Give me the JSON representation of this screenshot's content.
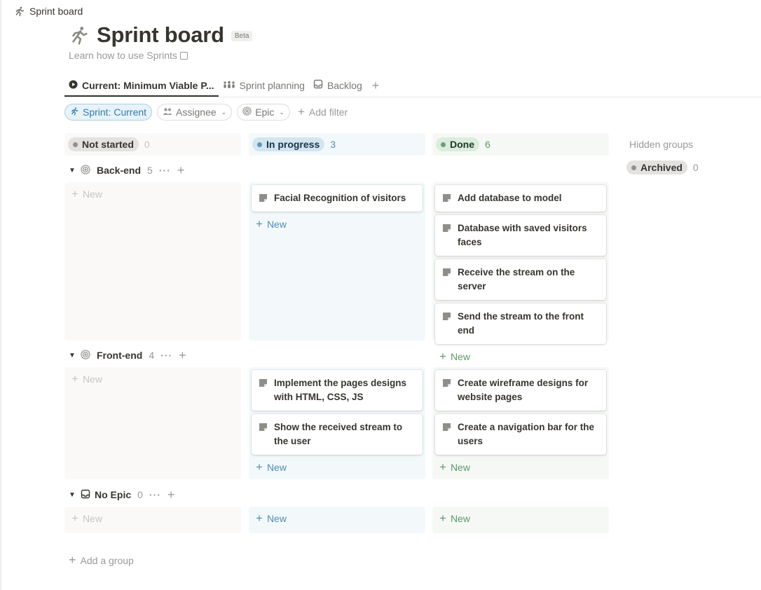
{
  "page": {
    "breadcrumb": "Sprint board",
    "title": "Sprint board",
    "badge": "Beta",
    "learn_link": "Learn how to use Sprints"
  },
  "tabs": [
    {
      "label": "Current: Minimum Viable P...",
      "icon": "play-circle-icon",
      "active": true
    },
    {
      "label": "Sprint planning",
      "icon": "people-group-icon"
    },
    {
      "label": "Backlog",
      "icon": "inbox-tray-icon"
    }
  ],
  "filters": {
    "sprint": "Sprint: Current",
    "assignee": "Assignee",
    "epic": "Epic",
    "add_filter": "Add filter"
  },
  "columns": [
    {
      "label": "Not started",
      "count": "0",
      "color": "#9b9a97"
    },
    {
      "label": "In progress",
      "count": "3",
      "color": "#4d8db8"
    },
    {
      "label": "Done",
      "count": "6",
      "color": "#5a9b6a"
    }
  ],
  "groups": [
    {
      "name": "Back-end",
      "count": "5",
      "icon": "target-icon",
      "in_progress": [
        "Facial Recognition of visitors"
      ],
      "done": [
        "Add database to model",
        "Database with saved visitors faces",
        "Receive the stream on the server",
        "Send the stream to the front end"
      ]
    },
    {
      "name": "Front-end",
      "count": "4",
      "icon": "target-icon",
      "in_progress": [
        "Implement the pages designs with HTML, CSS, JS",
        "Show the received stream to the user"
      ],
      "done": [
        "Create wireframe designs for website pages",
        "Create a navigation bar for the users"
      ]
    },
    {
      "name": "No Epic",
      "count": "0",
      "icon": "inbox-tray-icon",
      "in_progress": [],
      "done": []
    }
  ],
  "new_label": "New",
  "hidden_groups": {
    "title": "Hidden groups",
    "archived": "Archived",
    "archived_count": "0"
  },
  "add_group": "Add a group",
  "colors": {
    "accent_blue": "#2f7bb4",
    "text": "#37352f",
    "muted": "#9b9a97"
  }
}
